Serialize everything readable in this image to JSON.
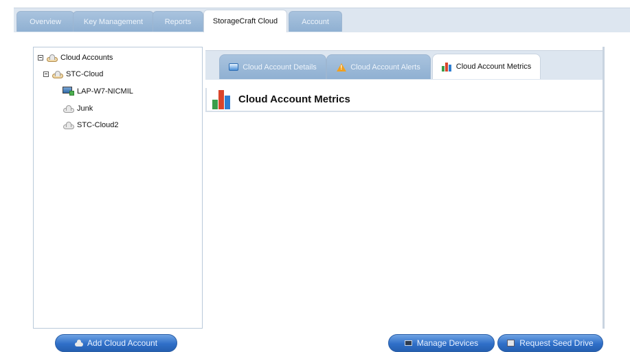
{
  "top_tabs": [
    {
      "label": "Overview"
    },
    {
      "label": "Key Management"
    },
    {
      "label": "Reports"
    },
    {
      "label": "StorageCraft Cloud"
    },
    {
      "label": "Account"
    }
  ],
  "tree": {
    "root": "Cloud Accounts",
    "group": "STC-Cloud",
    "items": [
      "LAP-W7-NICMIL",
      "Junk",
      "STC-Cloud2"
    ]
  },
  "sub_tabs": [
    {
      "label": "Cloud Account Details"
    },
    {
      "label": "Cloud Account Alerts"
    },
    {
      "label": "Cloud Account Metrics"
    }
  ],
  "metrics_title": "Cloud Account Metrics",
  "buttons": {
    "add_cloud_account": "Add Cloud Account",
    "manage_devices": "Manage Devices",
    "request_seed_drive": "Request Seed Drive"
  },
  "colors": {
    "accent": "#2f6fc8",
    "tab_inactive": "#8fb0d2",
    "strip": "#dde6f0"
  }
}
